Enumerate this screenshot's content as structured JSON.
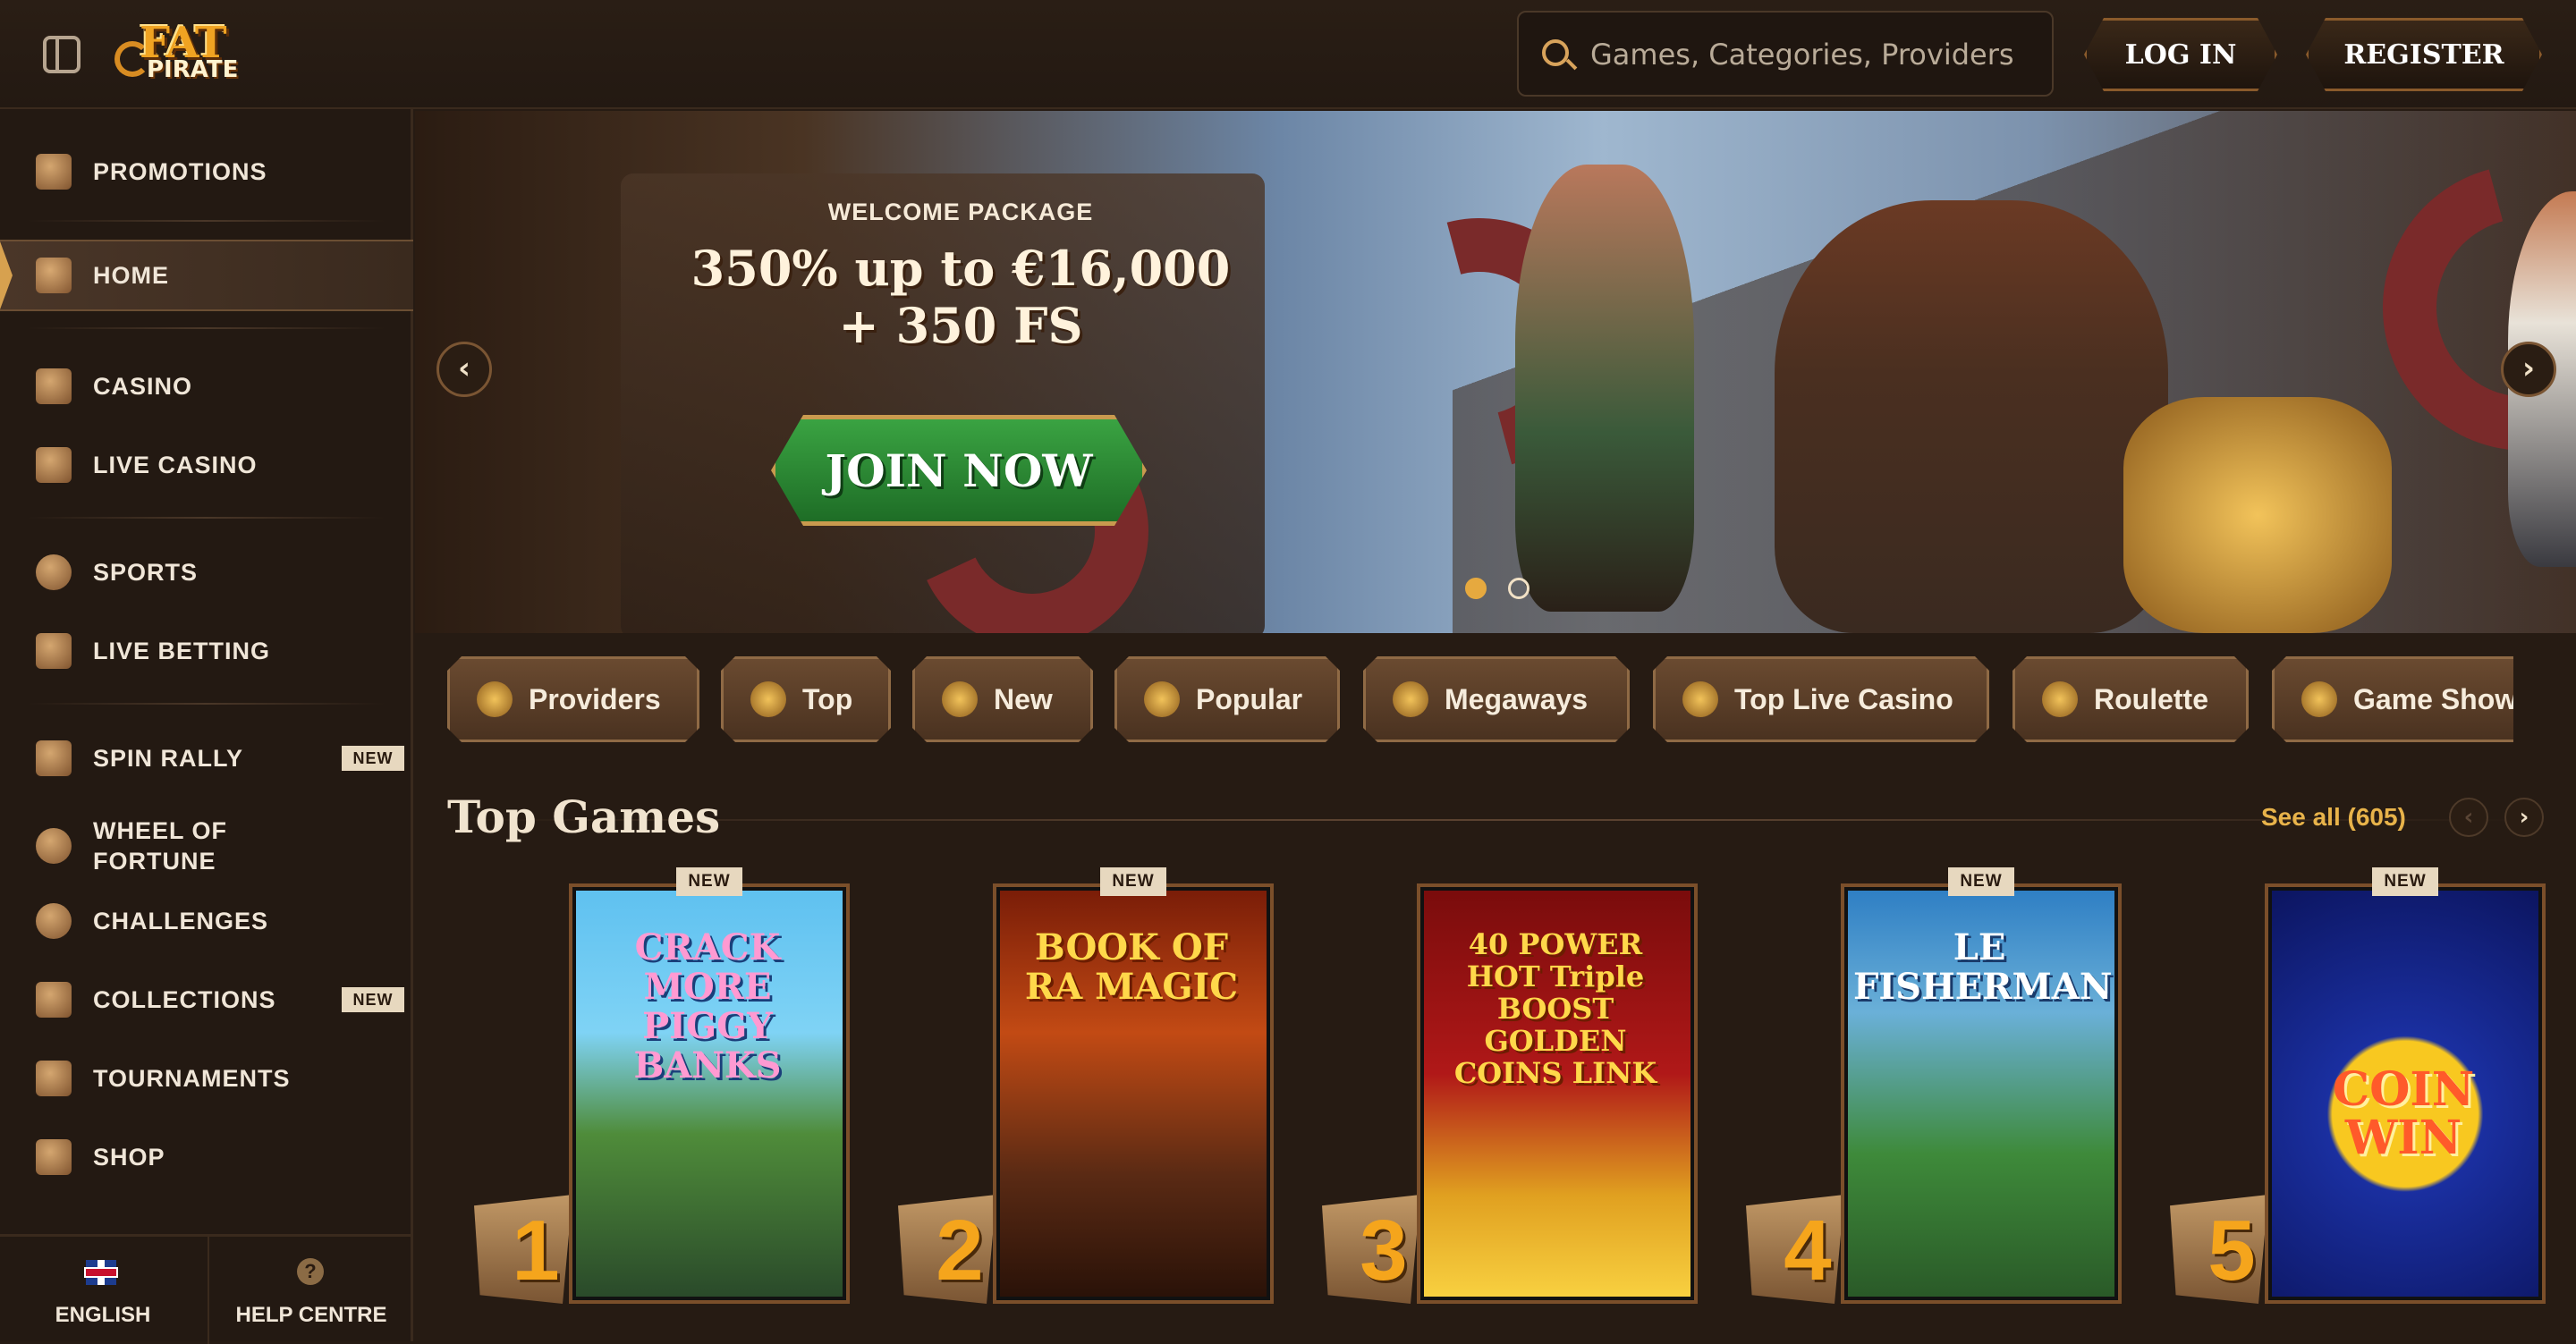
{
  "header": {
    "logo_top": "FAT",
    "logo_bottom": "PIRATE",
    "search_placeholder": "Games, Categories, Providers",
    "login_label": "LOG IN",
    "register_label": "REGISTER"
  },
  "sidebar": {
    "items": [
      {
        "label": "PROMOTIONS",
        "icon": "chest-icon"
      },
      {
        "label": "HOME",
        "icon": "home-icon",
        "active": true
      },
      {
        "label": "CASINO",
        "icon": "slot-machine-icon"
      },
      {
        "label": "LIVE CASINO",
        "icon": "cards-icon"
      },
      {
        "label": "SPORTS",
        "icon": "football-icon"
      },
      {
        "label": "LIVE BETTING",
        "icon": "live-icon"
      },
      {
        "label": "SPIN RALLY",
        "icon": "flag-icon",
        "badge": "NEW"
      },
      {
        "label": "WHEEL OF FORTUNE",
        "icon": "wheel-icon"
      },
      {
        "label": "CHALLENGES",
        "icon": "medal-icon"
      },
      {
        "label": "COLLECTIONS",
        "icon": "cards-collection-icon",
        "badge": "NEW"
      },
      {
        "label": "TOURNAMENTS",
        "icon": "trophy-icon"
      },
      {
        "label": "SHOP",
        "icon": "shop-bag-icon"
      }
    ],
    "footer": {
      "language": "ENGLISH",
      "help": "HELP CENTRE",
      "help_glyph": "?"
    }
  },
  "hero": {
    "eyebrow": "WELCOME PACKAGE",
    "bonus_line1": "350% up to €16,000",
    "bonus_line2": "+ 350 FS",
    "cta": "JOIN NOW",
    "prev_glyph": "‹",
    "next_glyph": "›",
    "slides_total": 2,
    "slide_active": 1
  },
  "categories": [
    "Providers",
    "Top",
    "New",
    "Popular",
    "Megaways",
    "Top Live Casino",
    "Roulette",
    "Game Show"
  ],
  "top_games": {
    "title": "Top Games",
    "see_all": "See all (605)",
    "prev_glyph": "‹",
    "next_glyph": "›",
    "games": [
      {
        "rank": "1",
        "title": "CRACK MORE PIGGY BANKS",
        "badge": "NEW"
      },
      {
        "rank": "2",
        "title": "BOOK OF RA MAGIC",
        "badge": "NEW"
      },
      {
        "rank": "3",
        "title": "40 POWER HOT Triple BOOST GOLDEN COINS LINK",
        "badge": ""
      },
      {
        "rank": "4",
        "title": "LE FISHERMAN",
        "badge": "NEW"
      },
      {
        "rank": "5",
        "title": "COIN WIN",
        "badge": "NEW"
      }
    ]
  },
  "colors": {
    "background": "#261b13",
    "accent_gold": "#e8b34a",
    "cta_green": "#2e8a36",
    "badge_bg": "#e7d8bf"
  }
}
